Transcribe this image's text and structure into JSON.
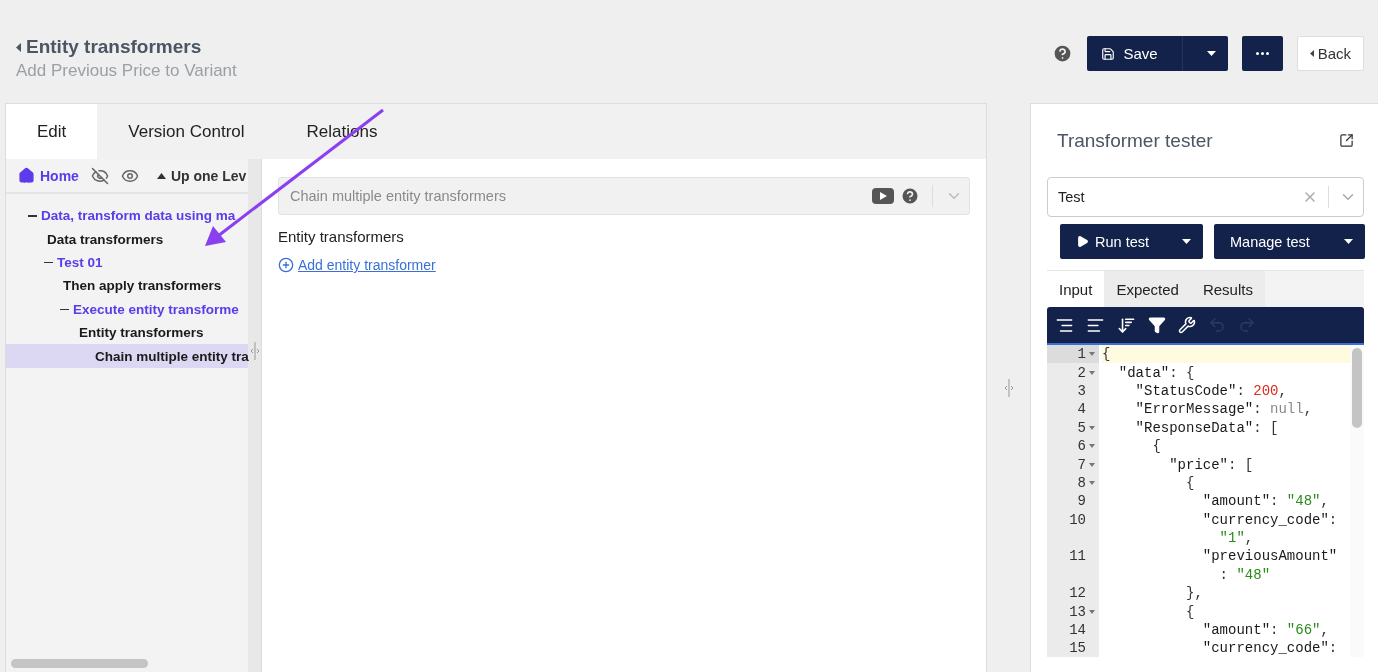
{
  "header": {
    "title": "Entity transformers",
    "subtitle": "Add Previous Price to Variant"
  },
  "actions": {
    "save": "Save",
    "back": "Back"
  },
  "tabs": [
    {
      "label": "Edit",
      "selected": true
    },
    {
      "label": "Version Control",
      "selected": false
    },
    {
      "label": "Relations",
      "selected": false
    }
  ],
  "tree_toolbar": {
    "home": "Home",
    "up": "Up one Lev"
  },
  "tree": [
    {
      "label": "Data, transform data using ma",
      "kind": "group",
      "expanded": true,
      "selected": false,
      "children": [
        {
          "label": "Data transformers",
          "kind": "leaf",
          "selected": false
        },
        {
          "label": "Test 01",
          "kind": "group",
          "expanded": true,
          "selected": false,
          "children": [
            {
              "label": "Then apply transformers",
              "kind": "leaf",
              "selected": false
            },
            {
              "label": "Execute entity transforme",
              "kind": "group",
              "expanded": true,
              "selected": false,
              "children": [
                {
                  "label": "Entity transformers",
                  "kind": "leaf",
                  "selected": false,
                  "children": [
                    {
                      "label": "Chain multiple entity tra",
                      "kind": "leaf",
                      "selected": true
                    }
                  ]
                }
              ]
            }
          ]
        }
      ]
    }
  ],
  "editor": {
    "selector": {
      "value": "Chain multiple entity transformers"
    },
    "section_title": "Entity transformers",
    "add_link": "Add entity transformer"
  },
  "tester": {
    "title": "Transformer tester",
    "test_select": {
      "value": "Test"
    },
    "buttons": [
      {
        "label": "Run test",
        "kind": "run"
      },
      {
        "label": "Manage test",
        "kind": "manage"
      }
    ],
    "tabs": [
      {
        "label": "Input",
        "selected": true
      },
      {
        "label": "Expected",
        "selected": false
      },
      {
        "label": "Results",
        "selected": false
      }
    ],
    "code_lines": [
      {
        "number": "1",
        "foldable": true,
        "active": true,
        "tokens": [
          {
            "kind": "punct",
            "text": "{"
          }
        ]
      },
      {
        "number": "2",
        "foldable": true,
        "active": false,
        "tokens": [
          {
            "kind": "key",
            "text": "  \"data\""
          },
          {
            "kind": "punct",
            "text": ": {"
          }
        ]
      },
      {
        "number": "3",
        "foldable": false,
        "active": false,
        "tokens": [
          {
            "kind": "key",
            "text": "    \"StatusCode\""
          },
          {
            "kind": "punct",
            "text": ": "
          },
          {
            "kind": "number",
            "text": "200"
          },
          {
            "kind": "punct",
            "text": ","
          }
        ]
      },
      {
        "number": "4",
        "foldable": false,
        "active": false,
        "tokens": [
          {
            "kind": "key",
            "text": "    \"ErrorMessage\""
          },
          {
            "kind": "punct",
            "text": ": "
          },
          {
            "kind": "null",
            "text": "null"
          },
          {
            "kind": "punct",
            "text": ","
          }
        ]
      },
      {
        "number": "5",
        "foldable": true,
        "active": false,
        "tokens": [
          {
            "kind": "key",
            "text": "    \"ResponseData\""
          },
          {
            "kind": "punct",
            "text": ": ["
          }
        ]
      },
      {
        "number": "6",
        "foldable": true,
        "active": false,
        "tokens": [
          {
            "kind": "punct",
            "text": "      {"
          }
        ]
      },
      {
        "number": "7",
        "foldable": true,
        "active": false,
        "tokens": [
          {
            "kind": "key",
            "text": "        \"price\""
          },
          {
            "kind": "punct",
            "text": ": ["
          }
        ]
      },
      {
        "number": "8",
        "foldable": true,
        "active": false,
        "tokens": [
          {
            "kind": "punct",
            "text": "          {"
          }
        ]
      },
      {
        "number": "9",
        "foldable": false,
        "active": false,
        "tokens": [
          {
            "kind": "key",
            "text": "            \"amount\""
          },
          {
            "kind": "punct",
            "text": ": "
          },
          {
            "kind": "string",
            "text": "\"48\""
          },
          {
            "kind": "punct",
            "text": ","
          }
        ]
      },
      {
        "number": "10",
        "foldable": false,
        "active": false,
        "tokens": [
          {
            "kind": "key",
            "text": "            \"currency_code\""
          },
          {
            "kind": "punct",
            "text": ":"
          }
        ]
      },
      {
        "foldable": false,
        "active": false,
        "tokens": [
          {
            "kind": "string",
            "text": "              \"1\""
          },
          {
            "kind": "punct",
            "text": ","
          }
        ]
      },
      {
        "number": "11",
        "foldable": false,
        "active": false,
        "tokens": [
          {
            "kind": "key",
            "text": "            \"previousAmount\""
          }
        ]
      },
      {
        "foldable": false,
        "active": false,
        "tokens": [
          {
            "kind": "punct",
            "text": "              : "
          },
          {
            "kind": "string",
            "text": "\"48\""
          }
        ]
      },
      {
        "number": "12",
        "foldable": false,
        "active": false,
        "tokens": [
          {
            "kind": "punct",
            "text": "          },"
          }
        ]
      },
      {
        "number": "13",
        "foldable": true,
        "active": false,
        "tokens": [
          {
            "kind": "punct",
            "text": "          {"
          }
        ]
      },
      {
        "number": "14",
        "foldable": false,
        "active": false,
        "tokens": [
          {
            "kind": "key",
            "text": "            \"amount\""
          },
          {
            "kind": "punct",
            "text": ": "
          },
          {
            "kind": "string",
            "text": "\"66\""
          },
          {
            "kind": "punct",
            "text": ","
          }
        ]
      },
      {
        "number": "15",
        "foldable": false,
        "active": false,
        "tokens": [
          {
            "kind": "key",
            "text": "            \"currency_code\""
          },
          {
            "kind": "punct",
            "text": ":"
          }
        ]
      }
    ]
  }
}
